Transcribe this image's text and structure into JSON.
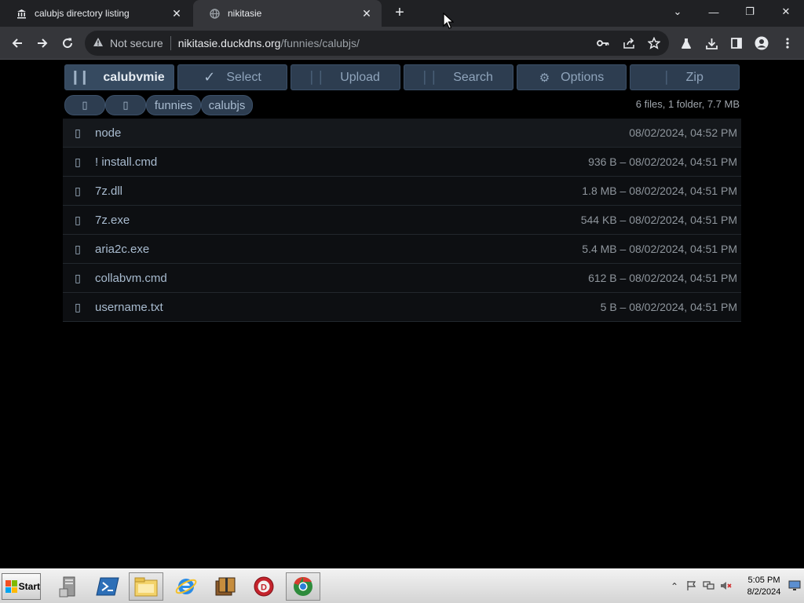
{
  "browser": {
    "tabs": [
      {
        "title": "calubjs directory listing",
        "favicon": "bank-icon",
        "active": false
      },
      {
        "title": "nikitasie",
        "favicon": "globe-icon",
        "active": true
      }
    ],
    "new_tab_label": "+",
    "window_controls": {
      "dropdown": "⌄",
      "minimize": "—",
      "restore": "❐",
      "close": "✕"
    },
    "security_label": "Not secure",
    "url_host": "nikitasie.duckdns.org",
    "url_path": "/funnies/calubjs/"
  },
  "toolbar": {
    "buttons": [
      {
        "label": "calubvmie",
        "icon": "grip-icon",
        "active": true
      },
      {
        "label": "Select",
        "icon": "check-icon",
        "active": false
      },
      {
        "label": "Upload",
        "icon": "upload-icon",
        "active": false
      },
      {
        "label": "Search",
        "icon": "search-icon",
        "active": false
      },
      {
        "label": "Options",
        "icon": "gear-icon",
        "active": false
      },
      {
        "label": "Zip",
        "icon": "zip-icon",
        "active": false
      }
    ]
  },
  "breadcrumbs": {
    "items": [
      {
        "label": "",
        "icon": "home-icon"
      },
      {
        "label": "",
        "icon": "folder-icon"
      },
      {
        "label": "funnies"
      },
      {
        "label": "calubjs"
      }
    ],
    "summary": "6 files, 1 folder, 7.7 MB"
  },
  "files": [
    {
      "name": "node",
      "meta": "08/02/2024, 04:52 PM",
      "kind": "folder"
    },
    {
      "name": "! install.cmd",
      "meta": "936 B – 08/02/2024, 04:51 PM",
      "kind": "file"
    },
    {
      "name": "7z.dll",
      "meta": "1.8 MB – 08/02/2024, 04:51 PM",
      "kind": "file"
    },
    {
      "name": "7z.exe",
      "meta": "544 KB – 08/02/2024, 04:51 PM",
      "kind": "file"
    },
    {
      "name": "aria2c.exe",
      "meta": "5.4 MB – 08/02/2024, 04:51 PM",
      "kind": "file"
    },
    {
      "name": "collabvm.cmd",
      "meta": "612 B – 08/02/2024, 04:51 PM",
      "kind": "file"
    },
    {
      "name": "username.txt",
      "meta": "5 B – 08/02/2024, 04:51 PM",
      "kind": "file"
    }
  ],
  "taskbar": {
    "start_label": "Start",
    "time": "5:05 PM",
    "date": "8/2/2024",
    "apps": [
      "server-manager-icon",
      "powershell-icon",
      "file-explorer-icon",
      "internet-explorer-icon",
      "archive-icon",
      "red-circle-app-icon",
      "chrome-icon"
    ]
  },
  "colors": {
    "accent_button": "#2d3d50",
    "link_text": "#a8bbcf",
    "page_bg": "#000000"
  }
}
